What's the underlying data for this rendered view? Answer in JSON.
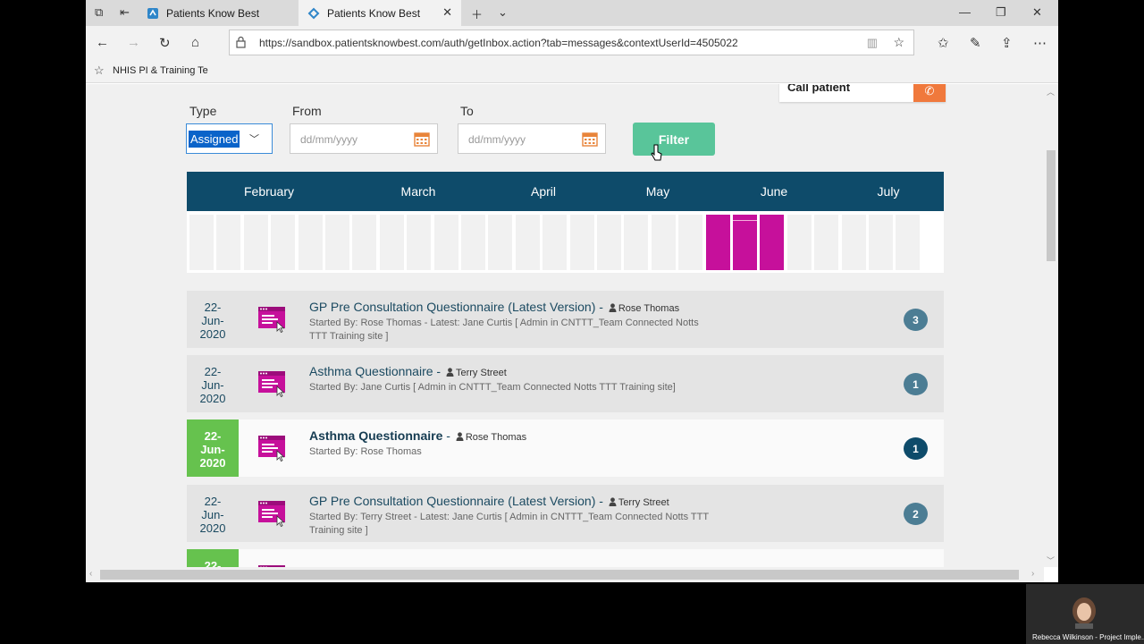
{
  "browser": {
    "tabs": [
      {
        "label": "Patients Know Best",
        "active": false
      },
      {
        "label": "Patients Know Best",
        "active": true
      }
    ],
    "url": "https://sandbox.patientsknowbest.com/auth/getInbox.action?tab=messages&contextUserId=4505022",
    "favorites": [
      {
        "label": "NHIS PI & Training Te"
      }
    ]
  },
  "call": {
    "label": "Call patient"
  },
  "filters": {
    "type_label": "Type",
    "type_value": "Assigned",
    "from_label": "From",
    "from_placeholder": "dd/mm/yyyy",
    "to_label": "To",
    "to_placeholder": "dd/mm/yyyy",
    "filter_button": "Filter"
  },
  "timeline": {
    "months": [
      "February",
      "March",
      "April",
      "May",
      "June",
      "July"
    ],
    "bar_count": 27,
    "highlighted_bars": [
      19,
      20,
      21
    ]
  },
  "messages": [
    {
      "date": [
        "22-",
        "Jun-",
        "2020"
      ],
      "title": "GP Pre Consultation Questionnaire (Latest Version)",
      "patient": "Rose Thomas",
      "sub": "Started By: Rose Thomas - Latest: Jane Curtis [ Admin in CNTTT_Team Connected Notts TTT Training site ]",
      "count": "3",
      "active": false
    },
    {
      "date": [
        "22-",
        "Jun-",
        "2020"
      ],
      "title": "Asthma Questionnaire",
      "patient": "Terry Street",
      "sub": "Started By: Jane Curtis [ Admin in CNTTT_Team Connected Notts TTT Training site]",
      "count": "1",
      "active": false
    },
    {
      "date": [
        "22-",
        "Jun-",
        "2020"
      ],
      "title": "Asthma Questionnaire",
      "patient": "Rose Thomas",
      "sub": "Started By: Rose Thomas",
      "count": "1",
      "active": true
    },
    {
      "date": [
        "22-",
        "Jun-",
        "2020"
      ],
      "title": "GP Pre Consultation Questionnaire (Latest Version)",
      "patient": "Terry Street",
      "sub": "Started By: Terry Street - Latest: Jane Curtis [ Admin in CNTTT_Team Connected Notts TTT Training site ]",
      "count": "2",
      "active": false
    },
    {
      "date": [
        "22-",
        "",
        ""
      ],
      "title": "",
      "patient": "",
      "sub": "",
      "count": "",
      "active": true
    }
  ],
  "webcam": {
    "name": "Rebecca Wilkinson - Project Imple..."
  },
  "colors": {
    "header": "#0e4b6a",
    "accent_magenta": "#c6109b",
    "filter_green": "#59c59a",
    "active_date_green": "#66c24e",
    "call_orange": "#f0793c"
  }
}
